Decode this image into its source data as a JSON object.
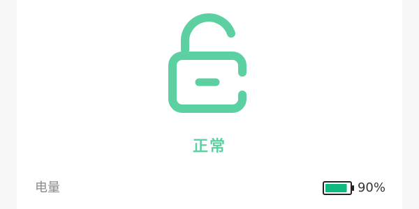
{
  "lock": {
    "state_icon": "unlocked-padlock-icon",
    "status_text": "正常",
    "accent_color": "#5cd0a0"
  },
  "battery": {
    "label": "电量",
    "percent_text": "90%",
    "level": 0.9,
    "icon": "battery-icon",
    "fill_color": "#10b981"
  }
}
